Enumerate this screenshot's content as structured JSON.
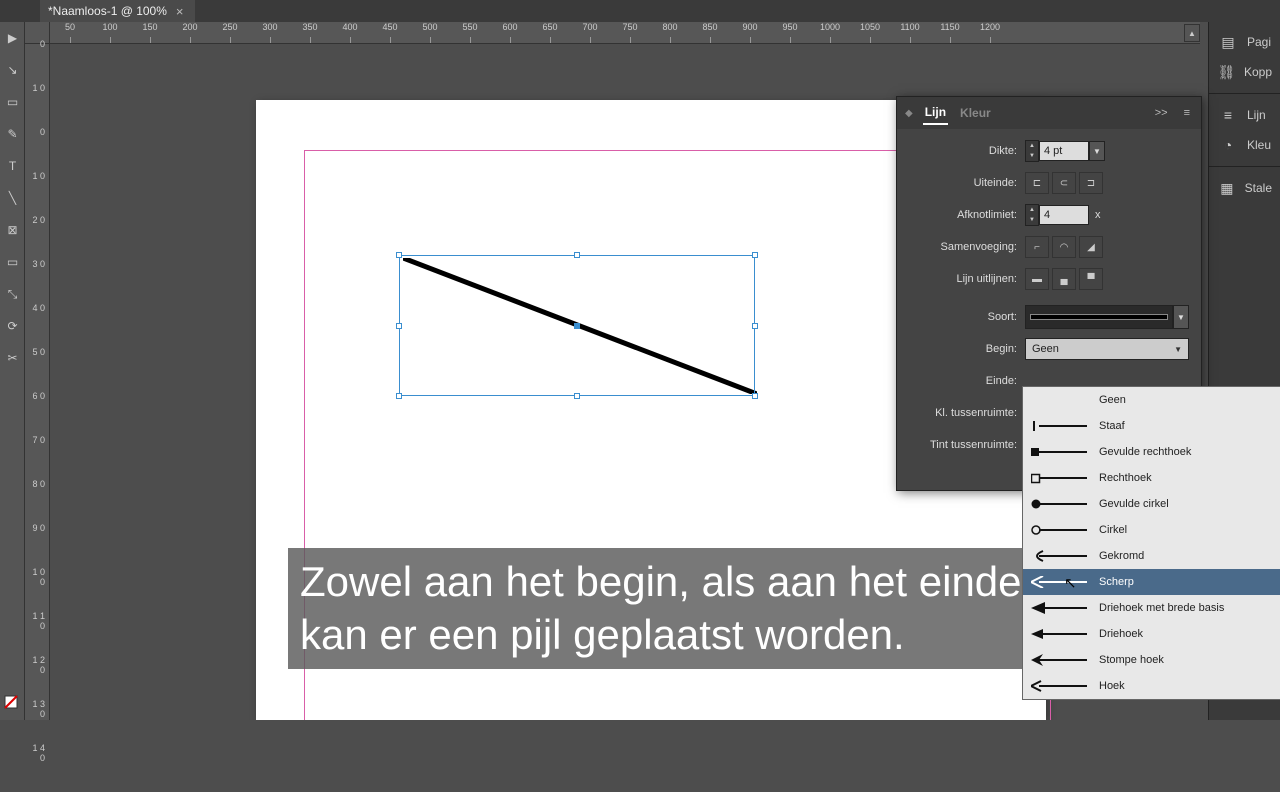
{
  "tab": {
    "title": "*Naamloos-1 @ 100%"
  },
  "ruler_h": [
    "50",
    "100",
    "150",
    "200",
    "250",
    "300",
    "350",
    "400",
    "450",
    "500",
    "550",
    "600",
    "650",
    "700",
    "750",
    "800",
    "850",
    "900",
    "950",
    "1000",
    "1050",
    "1100",
    "1150",
    "1200"
  ],
  "ruler_v": [
    "0",
    "1 0",
    "0",
    "1 0",
    "2 0",
    "3 0",
    "4 0",
    "5 0",
    "6 0",
    "7 0",
    "8 0",
    "9 0",
    "1 0 0",
    "1 1 0",
    "1 2 0",
    "1 3 0",
    "1 4 0"
  ],
  "panel": {
    "tabs": {
      "lijn": "Lijn",
      "kleur": "Kleur"
    },
    "labels": {
      "dikte": "Dikte:",
      "uiteinde": "Uiteinde:",
      "afknotlimiet": "Afknotlimiet:",
      "samenvoeging": "Samenvoeging:",
      "uitlijnen": "Lijn uitlijnen:",
      "soort": "Soort:",
      "begin": "Begin:",
      "einde": "Einde:",
      "kl_tussenruimte": "Kl. tussenruimte:",
      "tint_tussenruimte": "Tint tussenruimte:"
    },
    "values": {
      "dikte": "4 pt",
      "afknotlimiet": "4",
      "x": "x",
      "begin_selected": "Geen"
    }
  },
  "arrow_menu": {
    "items": [
      {
        "label": "Geen",
        "kind": "none"
      },
      {
        "label": "Staaf",
        "kind": "bar"
      },
      {
        "label": "Gevulde rechthoek",
        "kind": "square-filled"
      },
      {
        "label": "Rechthoek",
        "kind": "square-outline"
      },
      {
        "label": "Gevulde cirkel",
        "kind": "circle-filled"
      },
      {
        "label": "Cirkel",
        "kind": "circle-outline"
      },
      {
        "label": "Gekromd",
        "kind": "curved"
      },
      {
        "label": "Scherp",
        "kind": "sharp",
        "highlighted": true
      },
      {
        "label": "Driehoek met brede basis",
        "kind": "triangle-wide"
      },
      {
        "label": "Driehoek",
        "kind": "triangle"
      },
      {
        "label": "Stompe hoek",
        "kind": "blunt"
      },
      {
        "label": "Hoek",
        "kind": "angle"
      }
    ]
  },
  "dock": {
    "items": [
      {
        "label": "Pagi",
        "icon": "pages"
      },
      {
        "label": "Kopp",
        "icon": "links"
      },
      {
        "label": "Lijn",
        "icon": "stroke"
      },
      {
        "label": "Kleu",
        "icon": "color"
      },
      {
        "label": "Stale",
        "icon": "swatches"
      }
    ]
  },
  "caption": "Zowel aan het begin, als aan het einde kan er een pijl geplaatst worden."
}
